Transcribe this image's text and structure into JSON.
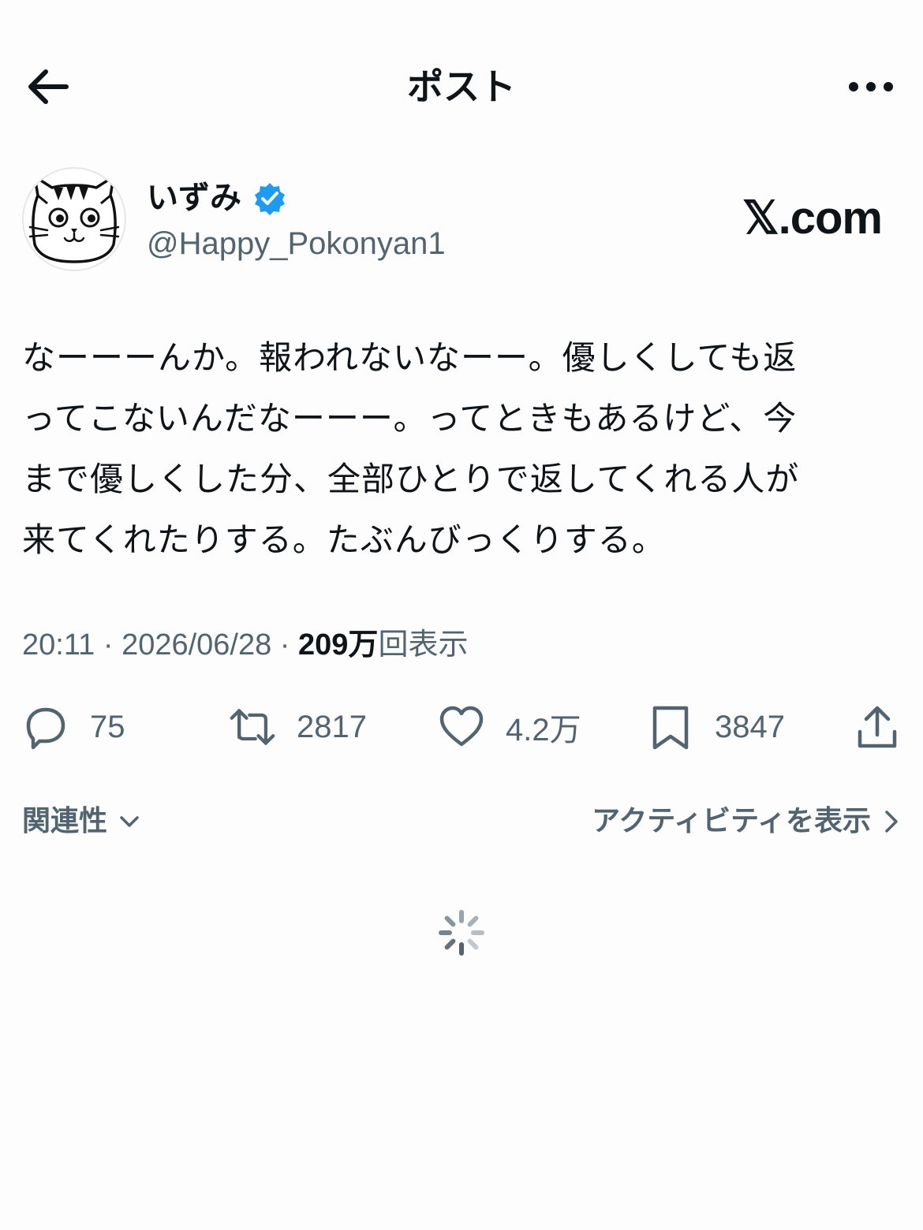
{
  "header": {
    "title": "ポスト",
    "back_icon": "arrow-left-icon",
    "more_icon": "more-horizontal-icon"
  },
  "author": {
    "name": "いずみ",
    "handle": "@Happy_Pokonyan1",
    "verified": true,
    "verified_color": "#1d9bf0",
    "brand": "𝕏.com"
  },
  "post": {
    "lines": [
      "なーーーんか。報われないなーー。優しくしても返",
      "ってこないんだなーーー。ってときもあるけど、今",
      "まで優しくした分、全部ひとりで返してくれる人が",
      "来てくれたりする。たぶんびっくりする。"
    ]
  },
  "meta": {
    "time": "20:11",
    "sep1": " · ",
    "date": "2026/06/28",
    "sep2": " · ",
    "views_count": "209万",
    "views_label": "回表示"
  },
  "actions": {
    "replies": "75",
    "reposts": "2817",
    "likes": "4.2万",
    "bookmarks": "3847"
  },
  "filters": {
    "sort_label": "関連性",
    "activity_label": "アクティビティを表示"
  },
  "colors": {
    "text_primary": "#0f1419",
    "text_secondary": "#536471",
    "background": "#fdfdfe"
  }
}
